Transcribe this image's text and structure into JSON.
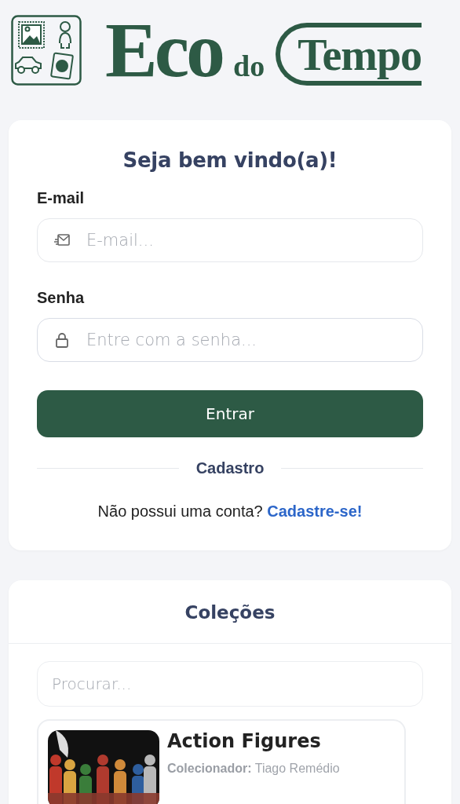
{
  "logo": {
    "words": [
      "Eco",
      "do",
      "Tempo"
    ]
  },
  "login": {
    "title": "Seja bem vindo(a)!",
    "fields": [
      {
        "kind": "email",
        "label": "E-mail",
        "placeholder": "E-mail..."
      },
      {
        "kind": "password",
        "label": "Senha",
        "placeholder": "Entre com a senha..."
      }
    ],
    "submit": "Entrar",
    "divider": "Cadastro",
    "signup_prompt": "Não possui uma conta?",
    "signup_link": "Cadastre-se!"
  },
  "collections": {
    "title": "Coleções",
    "search": {
      "placeholder": "Procurar..."
    },
    "items": [
      {
        "kind": "picture",
        "title": "Action Figures",
        "collector": "**Colecionador:** Tiago Remédio"
      }
    ]
  }
}
